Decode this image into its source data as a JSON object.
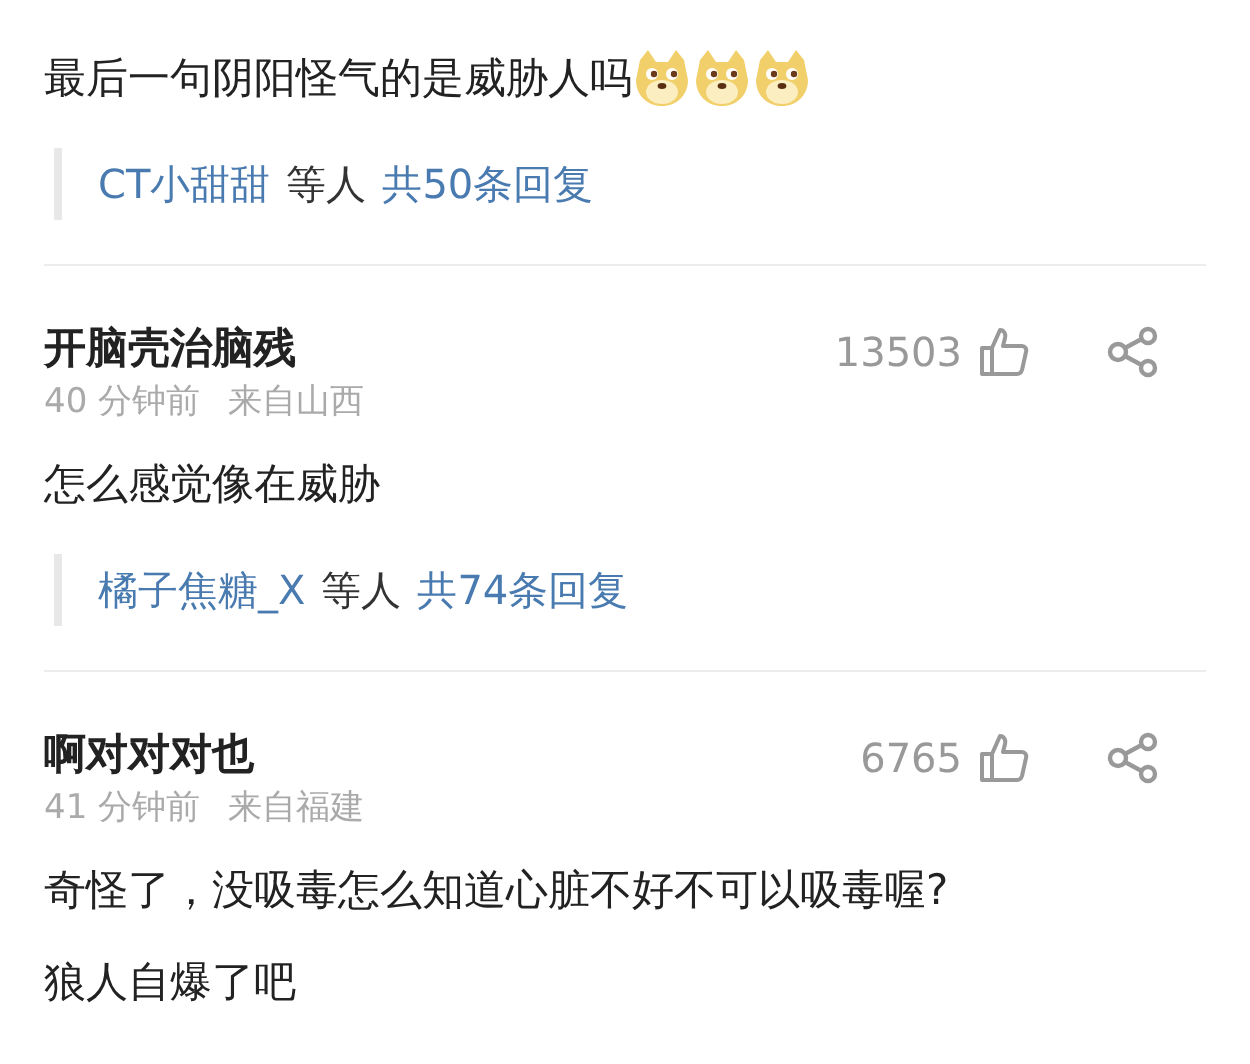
{
  "comments": [
    {
      "lines": [
        "最后一句阴阳怪气的是威胁人吗"
      ],
      "stickers": [
        {
          "kind": "doge"
        },
        {
          "kind": "doge"
        },
        {
          "kind": "doge"
        }
      ],
      "replies": {
        "user": "CT小甜甜",
        "suffix": "等人",
        "total": "共50条回复"
      }
    },
    {
      "author": "开脑壳治脑残",
      "time": "40 分钟前",
      "location": "来自山西",
      "likes": "13503",
      "lines": [
        "怎么感觉像在威胁"
      ],
      "replies": {
        "user": "橘子焦糖_X",
        "suffix": "等人",
        "total": "共74条回复"
      }
    },
    {
      "author": "啊对对对也",
      "time": "41 分钟前",
      "location": "来自福建",
      "likes": "6765",
      "lines": [
        "奇怪了，没吸毒怎么知道心脏不好不可以吸毒喔?",
        "狼人自爆了吧"
      ]
    }
  ]
}
